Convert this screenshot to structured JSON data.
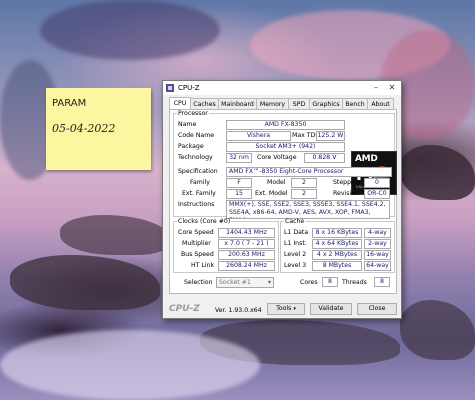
{
  "sticky_note": {
    "line1": "PARAM",
    "line2": "05-04-2022"
  },
  "window": {
    "title": "CPU-Z",
    "controls": {
      "minimize": "–",
      "close": "✕"
    },
    "tabs": [
      "CPU",
      "Caches",
      "Mainboard",
      "Memory",
      "SPD",
      "Graphics",
      "Bench",
      "About"
    ],
    "active_tab": "CPU"
  },
  "processor": {
    "group_label": "Processor",
    "name_label": "Name",
    "name": "AMD FX-8350",
    "code_name_label": "Code Name",
    "code_name": "Vishera",
    "max_tdp_label": "Max TDP",
    "max_tdp": "125.2 W",
    "package_label": "Package",
    "package": "Socket AM3+ (942)",
    "technology_label": "Technology",
    "technology": "32 nm",
    "core_voltage_label": "Core Voltage",
    "core_voltage": "0.828 V",
    "specification_label": "Specification",
    "specification": "AMD FX™-8350 Eight-Core Processor",
    "family_label": "Family",
    "family": "F",
    "model_label": "Model",
    "model": "2",
    "stepping_label": "Stepping",
    "stepping": "0",
    "ext_family_label": "Ext. Family",
    "ext_family": "15",
    "ext_model_label": "Ext. Model",
    "ext_model": "2",
    "revision_label": "Revision",
    "revision": "OR-C0",
    "instructions_label": "Instructions",
    "instructions": "MMX(+), SSE, SSE2, SSE3, SSSE3, SSE4.1, SSE4.2, SSE4A, x86-64, AMD-V, AES, AVX, XOP, FMA3, FMA4",
    "logo": {
      "brand": "AMD",
      "series": "FX",
      "tagline": "UNLOCKED"
    }
  },
  "clocks": {
    "group_label": "Clocks (Core #0)",
    "core_speed_label": "Core Speed",
    "core_speed": "1404.43 MHz",
    "multiplier_label": "Multiplier",
    "multiplier": "x 7.0 ( 7 - 21 )",
    "bus_speed_label": "Bus Speed",
    "bus_speed": "200.63 MHz",
    "ht_link_label": "HT Link",
    "ht_link": "2608.24 MHz"
  },
  "cache": {
    "group_label": "Cache",
    "rows": [
      {
        "label": "L1 Data",
        "size": "8 x 16 KBytes",
        "assoc": "4-way"
      },
      {
        "label": "L1 Inst.",
        "size": "4 x 64 KBytes",
        "assoc": "2-way"
      },
      {
        "label": "Level 2",
        "size": "4 x 2 MBytes",
        "assoc": "16-way"
      },
      {
        "label": "Level 3",
        "size": "8 MBytes",
        "assoc": "64-way"
      }
    ]
  },
  "selection": {
    "label": "Selection",
    "value": "Socket #1",
    "cores_label": "Cores",
    "cores": "8",
    "threads_label": "Threads",
    "threads": "8"
  },
  "footer": {
    "brand": "CPU-Z",
    "version": "Ver. 1.93.0.x64",
    "tools": "Tools",
    "validate": "Validate",
    "close": "Close"
  }
}
